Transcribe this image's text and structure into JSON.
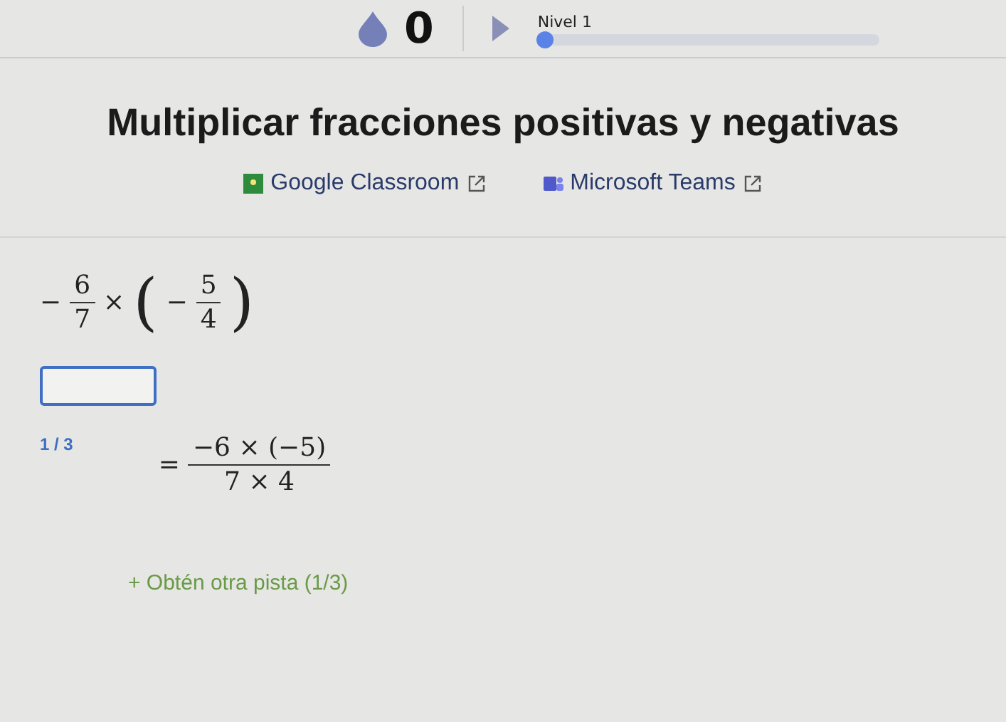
{
  "header": {
    "streak_count": "0",
    "level_label": "Nivel 1",
    "level": 0.02
  },
  "title": "Multiplicar fracciones positivas y negativas",
  "share_links": [
    {
      "kind": "classroom",
      "label": "Google Classroom"
    },
    {
      "kind": "teams",
      "label": "Microsoft Teams"
    }
  ],
  "problem": {
    "sign": "−",
    "numerator": "6",
    "denominator": "7",
    "operator": "×",
    "open": "(",
    "inner_sign": "−",
    "inner_numerator": "5",
    "inner_denominator": "4",
    "close": ")"
  },
  "hint": {
    "counter": "1 / 3",
    "equals": "=",
    "numerator": "−6 × (−5)",
    "denominator": "7 × 4"
  },
  "more_hints": "+ Obtén otra pista (1/3)"
}
